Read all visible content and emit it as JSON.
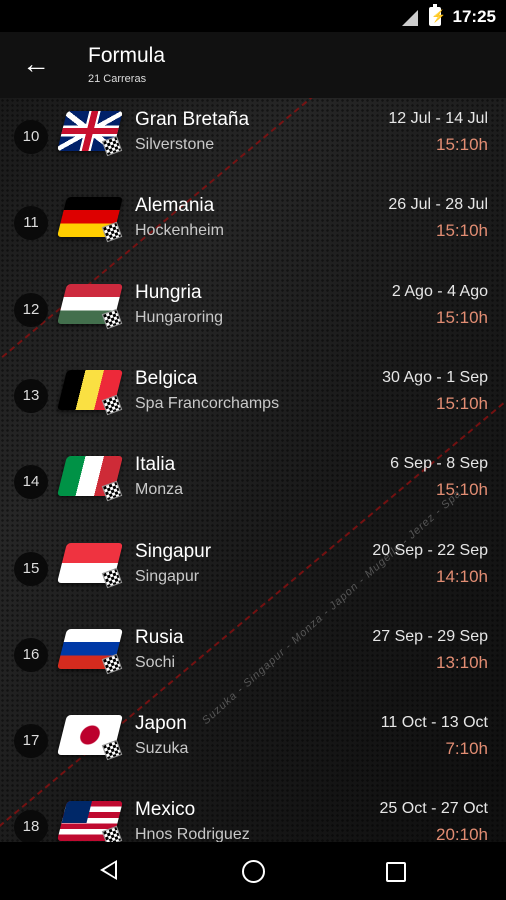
{
  "status": {
    "time": "17:25"
  },
  "appbar": {
    "title": "Formula",
    "subtitle": "21 Carreras"
  },
  "background_text": "Suzuka - Singapur - Monza - Japon - Mugello - Jerez - Spa",
  "races": [
    {
      "num": "10",
      "name": "Gran Bretaña",
      "circuit": "Silverstone",
      "dates": "12 Jul - 14 Jul",
      "time": "15:10h",
      "flag": "gb"
    },
    {
      "num": "11",
      "name": "Alemania",
      "circuit": "Hockenheim",
      "dates": "26 Jul - 28 Jul",
      "time": "15:10h",
      "flag": "de"
    },
    {
      "num": "12",
      "name": "Hungria",
      "circuit": "Hungaroring",
      "dates": "2 Ago - 4 Ago",
      "time": "15:10h",
      "flag": "hu"
    },
    {
      "num": "13",
      "name": "Belgica",
      "circuit": "Spa Francorchamps",
      "dates": "30 Ago - 1 Sep",
      "time": "15:10h",
      "flag": "be"
    },
    {
      "num": "14",
      "name": "Italia",
      "circuit": "Monza",
      "dates": "6 Sep - 8 Sep",
      "time": "15:10h",
      "flag": "it"
    },
    {
      "num": "15",
      "name": "Singapur",
      "circuit": "Singapur",
      "dates": "20 Sep - 22 Sep",
      "time": "14:10h",
      "flag": "sg"
    },
    {
      "num": "16",
      "name": "Rusia",
      "circuit": "Sochi",
      "dates": "27 Sep - 29 Sep",
      "time": "13:10h",
      "flag": "ru"
    },
    {
      "num": "17",
      "name": "Japon",
      "circuit": "Suzuka",
      "dates": "11 Oct - 13 Oct",
      "time": "7:10h",
      "flag": "jp"
    },
    {
      "num": "18",
      "name": "Mexico",
      "circuit": "Hnos Rodriguez",
      "dates": "25 Oct - 27 Oct",
      "time": "20:10h",
      "flag": "mx"
    }
  ],
  "colors": {
    "accent_time": "#e28d73",
    "stripe": "#8a1010"
  }
}
